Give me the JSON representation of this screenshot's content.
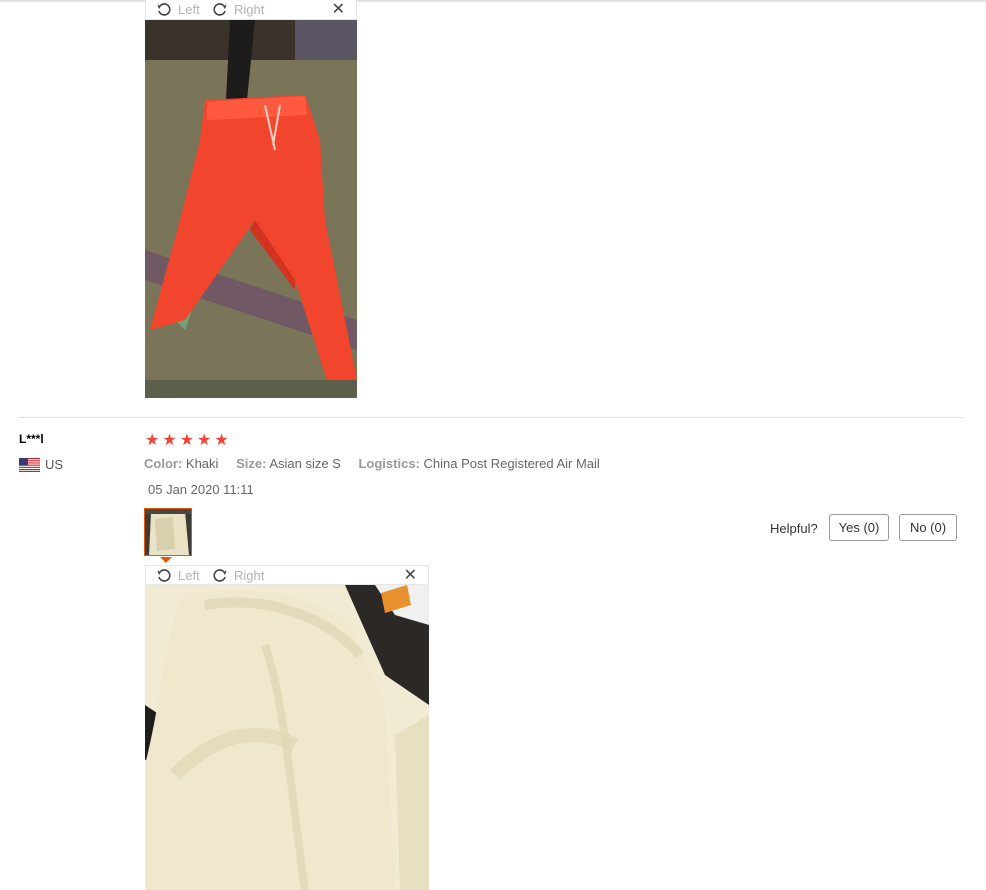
{
  "viewer_toolbar": {
    "left_label": "Left",
    "right_label": "Right",
    "close_glyph": "✕"
  },
  "photos": {
    "first": {
      "subject": "red pants"
    },
    "second": {
      "subject": "khaki pants"
    }
  },
  "review": {
    "buyer_name": "L***l",
    "country": "US",
    "rating": 5,
    "star_glyph": "★",
    "attributes": {
      "color_label": "Color:",
      "color_value": "Khaki",
      "size_label": "Size:",
      "size_value": "Asian size S",
      "logistics_label": "Logistics:",
      "logistics_value": "China Post Registered Air Mail"
    },
    "date": "05 Jan 2020 11:11",
    "helpful_label": "Helpful?",
    "yes_label": "Yes (0)",
    "no_label": "No (0)"
  },
  "colors": {
    "star": "#f44336",
    "thumb_border": "#e05a00",
    "divider": "#e6e6e6"
  }
}
